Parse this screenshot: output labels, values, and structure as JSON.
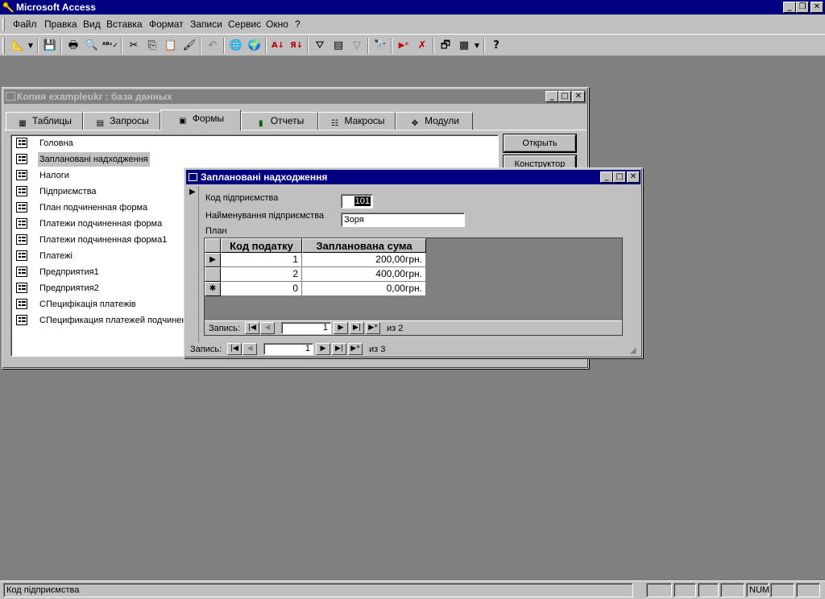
{
  "app": {
    "title": "Microsoft Access"
  },
  "menu": [
    "Файл",
    "Правка",
    "Вид",
    "Вставка",
    "Формат",
    "Записи",
    "Сервис",
    "Окно",
    "?"
  ],
  "toolbar": {
    "icons": [
      "design-view-icon",
      "save-icon",
      "print-icon",
      "print-preview-icon",
      "spelling-icon",
      "cut-icon",
      "copy-icon",
      "paste-icon",
      "format-painter-icon",
      "undo-icon",
      "insert-hyperlink-icon",
      "web-toolbar-icon",
      "sort-ascending-icon",
      "sort-descending-icon",
      "filter-by-selection-icon",
      "filter-by-form-icon",
      "apply-filter-icon",
      "find-icon",
      "new-record-icon",
      "delete-record-icon",
      "database-window-icon",
      "new-object-icon",
      "help-icon"
    ]
  },
  "db_window": {
    "title": "Копия exampleukr : база данных",
    "tabs": [
      "Таблицы",
      "Запросы",
      "Формы",
      "Отчеты",
      "Макросы",
      "Модули"
    ],
    "active_tab": "Формы",
    "items": [
      "Головна",
      "Заплановані надходження",
      "Налоги",
      "Підприємства",
      "План подчиненная форма",
      "Платежи подчиненная форма",
      "Платежи подчиненная форма1",
      "Платежі",
      "Предприятия1",
      "Предприятия2",
      "СПецифікація платежів",
      "СПецификация платежей подчинен"
    ],
    "selected_item": "Заплановані надходження",
    "buttons": {
      "open": "Открыть",
      "design": "Конструктор"
    }
  },
  "form_window": {
    "title": "Заплановані надходження",
    "fields": {
      "code_label": "Код підприємства",
      "code_value": "101",
      "name_label": "Найменування підприємства",
      "name_value": "Зоря",
      "plan_label": "План"
    },
    "subform": {
      "columns": [
        "Код податку",
        "Запланована сума"
      ],
      "rows": [
        {
          "code": "1",
          "amount": "200,00грн."
        },
        {
          "code": "2",
          "amount": "400,00грн."
        },
        {
          "code": "0",
          "amount": "0,00грн."
        }
      ],
      "nav": {
        "label": "Запись:",
        "current": "1",
        "of_label": "из 2"
      }
    },
    "nav": {
      "label": "Запись:",
      "current": "1",
      "of_label": "из 3"
    }
  },
  "status": {
    "text": "Код підприємства",
    "num": "NUM"
  }
}
